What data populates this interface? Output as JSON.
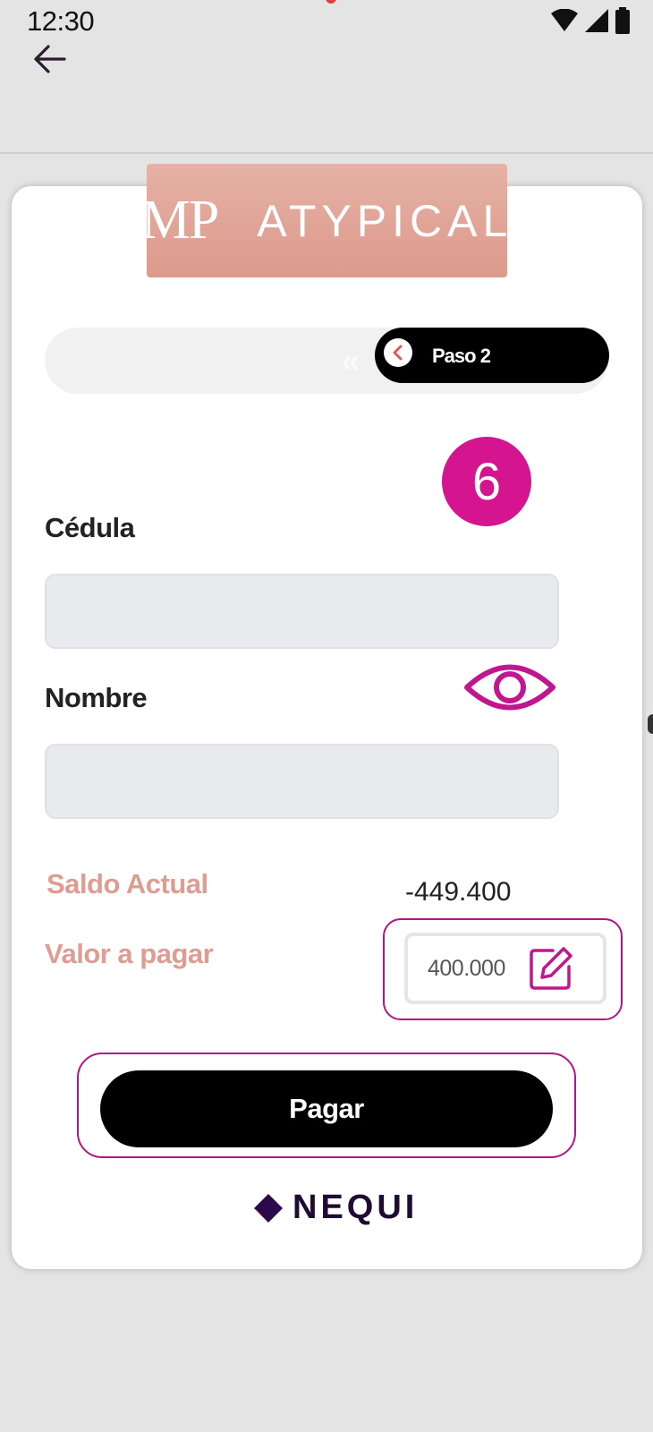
{
  "status_bar": {
    "time": "12:30",
    "icons": [
      "wifi-icon",
      "signal-icon",
      "battery-icon"
    ]
  },
  "header": {
    "back_icon": "arrow-left-icon"
  },
  "logo": {
    "mp": "MP",
    "brand": "ATYPICAL"
  },
  "stepper": {
    "label": "Paso 2"
  },
  "badge": {
    "number": "6"
  },
  "form": {
    "cedula_label": "Cédula",
    "cedula_value": "",
    "nombre_label": "Nombre",
    "nombre_value": ""
  },
  "balance": {
    "saldo_label": "Saldo Actual",
    "saldo_value": "-449.400",
    "valor_label": "Valor a pagar",
    "valor_value": "400.000"
  },
  "actions": {
    "pay_label": "Pagar"
  },
  "footer": {
    "brand": "NEQUI"
  },
  "colors": {
    "accent": "#d51490",
    "salmon": "#dd9d92",
    "logo_bg": "#e0a396",
    "primary_button": "#000000"
  }
}
